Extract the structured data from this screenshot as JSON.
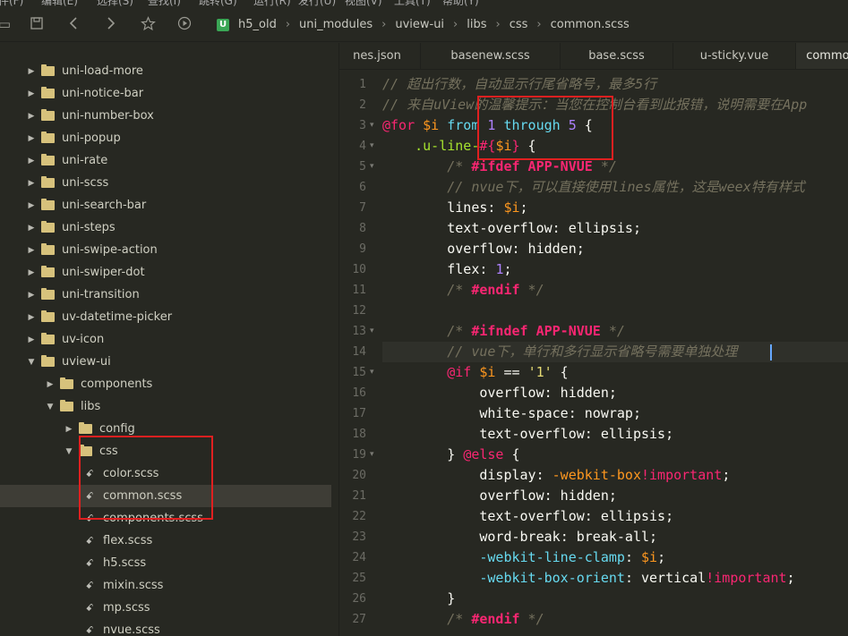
{
  "menubar": [
    "文件(F)",
    "编辑(E)",
    "选择(S)",
    "查找(I)",
    "跳转(G)",
    "运行(R)",
    "发行(U)",
    "视图(V)",
    "工具(T)",
    "帮助(Y)"
  ],
  "toolbar": {
    "icons": [
      "save-icon",
      "back-icon",
      "forward-icon",
      "star-icon",
      "run-icon"
    ]
  },
  "breadcrumb": {
    "logo": "U",
    "items": [
      "h5_old",
      "uni_modules",
      "uview-ui",
      "libs",
      "css",
      "common.scss"
    ]
  },
  "tree": [
    {
      "label": "uni-load-more",
      "type": "folder",
      "depth": 0,
      "arrow": "right"
    },
    {
      "label": "uni-notice-bar",
      "type": "folder",
      "depth": 0,
      "arrow": "right"
    },
    {
      "label": "uni-number-box",
      "type": "folder",
      "depth": 0,
      "arrow": "right"
    },
    {
      "label": "uni-popup",
      "type": "folder",
      "depth": 0,
      "arrow": "right"
    },
    {
      "label": "uni-rate",
      "type": "folder",
      "depth": 0,
      "arrow": "right"
    },
    {
      "label": "uni-scss",
      "type": "folder",
      "depth": 0,
      "arrow": "right"
    },
    {
      "label": "uni-search-bar",
      "type": "folder",
      "depth": 0,
      "arrow": "right"
    },
    {
      "label": "uni-steps",
      "type": "folder",
      "depth": 0,
      "arrow": "right"
    },
    {
      "label": "uni-swipe-action",
      "type": "folder",
      "depth": 0,
      "arrow": "right"
    },
    {
      "label": "uni-swiper-dot",
      "type": "folder",
      "depth": 0,
      "arrow": "right"
    },
    {
      "label": "uni-transition",
      "type": "folder",
      "depth": 0,
      "arrow": "right"
    },
    {
      "label": "uv-datetime-picker",
      "type": "folder",
      "depth": 0,
      "arrow": "right"
    },
    {
      "label": "uv-icon",
      "type": "folder",
      "depth": 0,
      "arrow": "right"
    },
    {
      "label": "uview-ui",
      "type": "folder",
      "depth": 0,
      "arrow": "down"
    },
    {
      "label": "components",
      "type": "folder",
      "depth": 1,
      "arrow": "right"
    },
    {
      "label": "libs",
      "type": "folder",
      "depth": 1,
      "arrow": "down"
    },
    {
      "label": "config",
      "type": "folder",
      "depth": 2,
      "arrow": "right"
    },
    {
      "label": "css",
      "type": "folder",
      "depth": 2,
      "arrow": "down"
    },
    {
      "label": "color.scss",
      "type": "file",
      "depth": 3
    },
    {
      "label": "common.scss",
      "type": "file",
      "depth": 3,
      "selected": true
    },
    {
      "label": "components.scss",
      "type": "file",
      "depth": 3
    },
    {
      "label": "flex.scss",
      "type": "file",
      "depth": 3
    },
    {
      "label": "h5.scss",
      "type": "file",
      "depth": 3
    },
    {
      "label": "mixin.scss",
      "type": "file",
      "depth": 3
    },
    {
      "label": "mp.scss",
      "type": "file",
      "depth": 3
    },
    {
      "label": "nvue.scss",
      "type": "file",
      "depth": 3
    }
  ],
  "tabs": [
    {
      "label": "nes.json",
      "active": false
    },
    {
      "label": "basenew.scss",
      "active": false
    },
    {
      "label": "base.scss",
      "active": false
    },
    {
      "label": "u-sticky.vue",
      "active": false
    },
    {
      "label": "common",
      "active": true
    }
  ],
  "editor": {
    "line_numbers": [
      "1",
      "2",
      "3",
      "4",
      "5",
      "6",
      "7",
      "8",
      "9",
      "10",
      "11",
      "12",
      "13",
      "14",
      "15",
      "16",
      "17",
      "18",
      "19",
      "20",
      "21",
      "22",
      "23",
      "24",
      "25",
      "26",
      "27"
    ],
    "lines": [
      {
        "segments": [
          {
            "c": "cm",
            "t": "// 超出行数，自动显示行尾省略号，最多5行"
          }
        ]
      },
      {
        "segments": [
          {
            "c": "cm",
            "t": "// 来自uView的温馨提示：当您在控制台看到此报错，说明需要在App"
          }
        ]
      },
      {
        "segments": [
          {
            "c": "at",
            "t": "@for"
          },
          {
            "c": "punc",
            "t": " "
          },
          {
            "c": "mag",
            "t": "$i"
          },
          {
            "c": "punc",
            "t": " "
          },
          {
            "c": "kw",
            "t": "from"
          },
          {
            "c": "punc",
            "t": " "
          },
          {
            "c": "num",
            "t": "1"
          },
          {
            "c": "punc",
            "t": " "
          },
          {
            "c": "kw",
            "t": "through"
          },
          {
            "c": "punc",
            "t": " "
          },
          {
            "c": "num",
            "t": "5"
          },
          {
            "c": "punc",
            "t": " {"
          }
        ]
      },
      {
        "segments": [
          {
            "c": "punc",
            "t": "    "
          },
          {
            "c": "sel",
            "t": ".u-line-"
          },
          {
            "c": "var",
            "t": "#{"
          },
          {
            "c": "mag",
            "t": "$i"
          },
          {
            "c": "var",
            "t": "}"
          },
          {
            "c": "punc",
            "t": " {"
          }
        ]
      },
      {
        "segments": [
          {
            "c": "punc",
            "t": "        "
          },
          {
            "c": "cm",
            "t": "/* "
          },
          {
            "c": "pre",
            "t": "#ifdef APP-NVUE"
          },
          {
            "c": "cm",
            "t": " */"
          }
        ]
      },
      {
        "segments": [
          {
            "c": "punc",
            "t": "        "
          },
          {
            "c": "cm",
            "t": "// nvue下，可以直接使用lines属性，这是weex特有样式"
          }
        ]
      },
      {
        "segments": [
          {
            "c": "punc",
            "t": "        "
          },
          {
            "c": "prop",
            "t": "lines"
          },
          {
            "c": "punc",
            "t": ": "
          },
          {
            "c": "mag",
            "t": "$i"
          },
          {
            "c": "punc",
            "t": ";"
          }
        ]
      },
      {
        "segments": [
          {
            "c": "punc",
            "t": "        "
          },
          {
            "c": "prop",
            "t": "text-overflow"
          },
          {
            "c": "punc",
            "t": ": ellipsis;"
          }
        ]
      },
      {
        "segments": [
          {
            "c": "punc",
            "t": "        "
          },
          {
            "c": "prop",
            "t": "overflow"
          },
          {
            "c": "punc",
            "t": ": hidden;"
          }
        ]
      },
      {
        "segments": [
          {
            "c": "punc",
            "t": "        "
          },
          {
            "c": "prop",
            "t": "flex"
          },
          {
            "c": "punc",
            "t": ": "
          },
          {
            "c": "num",
            "t": "1"
          },
          {
            "c": "punc",
            "t": ";"
          }
        ]
      },
      {
        "segments": [
          {
            "c": "punc",
            "t": "        "
          },
          {
            "c": "cm",
            "t": "/* "
          },
          {
            "c": "pre",
            "t": "#endif"
          },
          {
            "c": "cm",
            "t": " */"
          }
        ]
      },
      {
        "segments": [
          {
            "c": "punc",
            "t": ""
          }
        ]
      },
      {
        "segments": [
          {
            "c": "punc",
            "t": "        "
          },
          {
            "c": "cm",
            "t": "/* "
          },
          {
            "c": "pre",
            "t": "#ifndef APP-NVUE"
          },
          {
            "c": "cm",
            "t": " */"
          }
        ]
      },
      {
        "segments": [
          {
            "c": "punc",
            "t": "        "
          },
          {
            "c": "cm",
            "t": "// vue下，单行和多行显示省略号需要单独处理"
          }
        ],
        "current": true
      },
      {
        "segments": [
          {
            "c": "punc",
            "t": "        "
          },
          {
            "c": "at",
            "t": "@if"
          },
          {
            "c": "punc",
            "t": " "
          },
          {
            "c": "mag",
            "t": "$i"
          },
          {
            "c": "punc",
            "t": " == "
          },
          {
            "c": "str",
            "t": "'1'"
          },
          {
            "c": "punc",
            "t": " {"
          }
        ]
      },
      {
        "segments": [
          {
            "c": "punc",
            "t": "            "
          },
          {
            "c": "prop",
            "t": "overflow"
          },
          {
            "c": "punc",
            "t": ": hidden;"
          }
        ]
      },
      {
        "segments": [
          {
            "c": "punc",
            "t": "            "
          },
          {
            "c": "prop",
            "t": "white-space"
          },
          {
            "c": "punc",
            "t": ": nowrap;"
          }
        ]
      },
      {
        "segments": [
          {
            "c": "punc",
            "t": "            "
          },
          {
            "c": "prop",
            "t": "text-overflow"
          },
          {
            "c": "punc",
            "t": ": ellipsis;"
          }
        ]
      },
      {
        "segments": [
          {
            "c": "punc",
            "t": "        } "
          },
          {
            "c": "at",
            "t": "@else"
          },
          {
            "c": "punc",
            "t": " {"
          }
        ]
      },
      {
        "segments": [
          {
            "c": "punc",
            "t": "            "
          },
          {
            "c": "prop",
            "t": "display"
          },
          {
            "c": "punc",
            "t": ": "
          },
          {
            "c": "mag",
            "t": "-webkit-box"
          },
          {
            "c": "at",
            "t": "!important"
          },
          {
            "c": "punc",
            "t": ";"
          }
        ]
      },
      {
        "segments": [
          {
            "c": "punc",
            "t": "            "
          },
          {
            "c": "prop",
            "t": "overflow"
          },
          {
            "c": "punc",
            "t": ": hidden;"
          }
        ]
      },
      {
        "segments": [
          {
            "c": "punc",
            "t": "            "
          },
          {
            "c": "prop",
            "t": "text-overflow"
          },
          {
            "c": "punc",
            "t": ": ellipsis;"
          }
        ]
      },
      {
        "segments": [
          {
            "c": "punc",
            "t": "            "
          },
          {
            "c": "prop",
            "t": "word-break"
          },
          {
            "c": "punc",
            "t": ": break-all;"
          }
        ]
      },
      {
        "segments": [
          {
            "c": "punc",
            "t": "            "
          },
          {
            "c": "hl",
            "t": "-webkit-line-clamp"
          },
          {
            "c": "punc",
            "t": ": "
          },
          {
            "c": "mag",
            "t": "$i"
          },
          {
            "c": "punc",
            "t": ";"
          }
        ]
      },
      {
        "segments": [
          {
            "c": "punc",
            "t": "            "
          },
          {
            "c": "hl",
            "t": "-webkit-box-orient"
          },
          {
            "c": "punc",
            "t": ": vertical"
          },
          {
            "c": "at",
            "t": "!important"
          },
          {
            "c": "punc",
            "t": ";"
          }
        ]
      },
      {
        "segments": [
          {
            "c": "punc",
            "t": "        }"
          }
        ]
      },
      {
        "segments": [
          {
            "c": "punc",
            "t": "        "
          },
          {
            "c": "cm",
            "t": "/* "
          },
          {
            "c": "pre",
            "t": "#endif"
          },
          {
            "c": "cm",
            "t": " */"
          }
        ]
      }
    ]
  },
  "colors": {
    "background": "#272822",
    "annotation": "#e02020",
    "folder": "#d7c27c",
    "brand": "#3aa655"
  }
}
